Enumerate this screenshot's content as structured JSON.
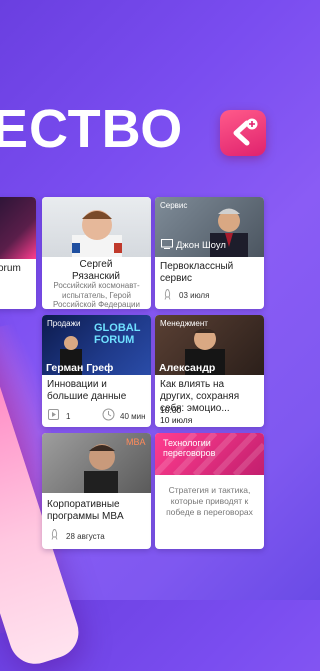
{
  "hero": {
    "headline": "ЕСТВО"
  },
  "cards": [
    {
      "partial_title": "orum"
    },
    {
      "name": "Сергей\nРязанский",
      "description": "Российский космонавт-испытатель, Герой Российской Федерации"
    },
    {
      "category": "Сервис",
      "overlay_name": "Джон Шоул",
      "title": "Первоклассный сервис",
      "date": "03 июля"
    },
    {
      "category": "Продажи",
      "overlay_name": "Герман Греф",
      "title": "Инновации и большие данные",
      "count": "1",
      "duration": "40 мин"
    },
    {
      "category": "Менеджмент",
      "overlay_name": "Александр Фридман",
      "title": "Как влиять на других, сохраняя себя: эмоцио...",
      "time": "10:00",
      "date": "10 июля"
    },
    {
      "badge": "MBA",
      "title": "Корпоративные программы MBA",
      "date": "28 августа"
    },
    {
      "header_title": "Технологии переговоров",
      "description": "Стратегия и тактика, которые приводят к победе в переговорах"
    }
  ],
  "colors": {
    "accent": "#e0226e",
    "bg": "#7a4df0"
  }
}
